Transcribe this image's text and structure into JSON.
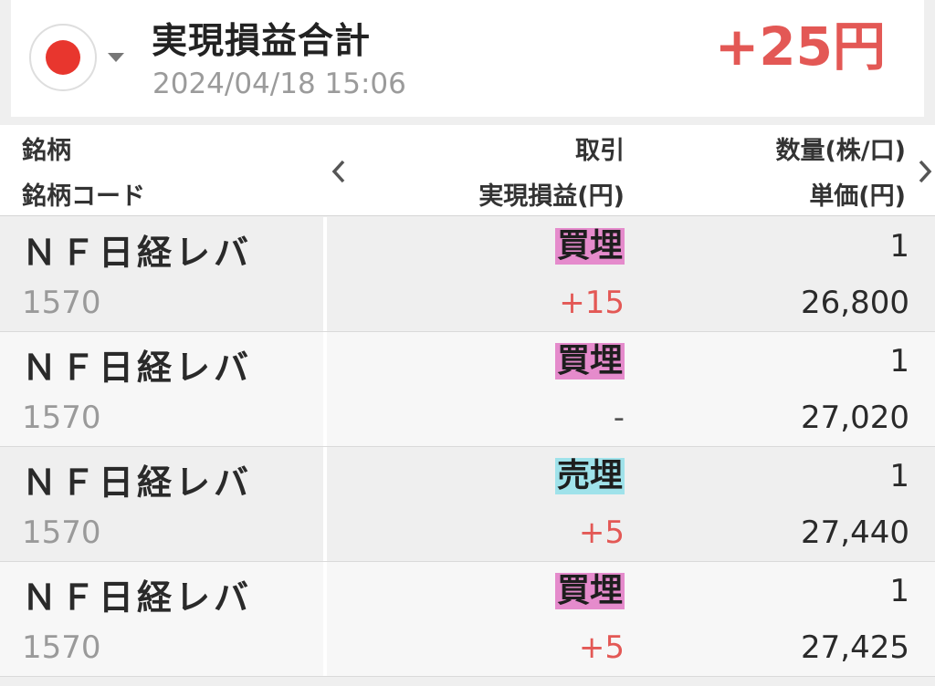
{
  "summary": {
    "flag_icon": "japan-flag-icon",
    "title": "実現損益合計",
    "datetime": "2024/04/18 15:06",
    "total": "+25円",
    "total_color": "#e35855"
  },
  "header": {
    "col1_line1": "銘柄",
    "col1_line2": "銘柄コード",
    "col2_line1": "取引",
    "col2_line2": "実現損益(円)",
    "col3_line1": "数量(株/口)",
    "col3_line2": "単価(円)",
    "prev_icon": "chevron-left-icon",
    "next_icon": "chevron-right-icon"
  },
  "rows": [
    {
      "name": "ＮＦ日経レバ",
      "code": "1570",
      "trade": "買埋",
      "trade_type": "buy",
      "pl": "+15",
      "qty": "1",
      "price": "26,800"
    },
    {
      "name": "ＮＦ日経レバ",
      "code": "1570",
      "trade": "買埋",
      "trade_type": "buy",
      "pl": "-",
      "qty": "1",
      "price": "27,020"
    },
    {
      "name": "ＮＦ日経レバ",
      "code": "1570",
      "trade": "売埋",
      "trade_type": "sell",
      "pl": "+5",
      "qty": "1",
      "price": "27,440"
    },
    {
      "name": "ＮＦ日経レバ",
      "code": "1570",
      "trade": "買埋",
      "trade_type": "buy",
      "pl": "+5",
      "qty": "1",
      "price": "27,425"
    }
  ],
  "colors": {
    "buy_badge": "#e58bcc",
    "sell_badge": "#9fe2ea",
    "profit": "#e35855"
  }
}
